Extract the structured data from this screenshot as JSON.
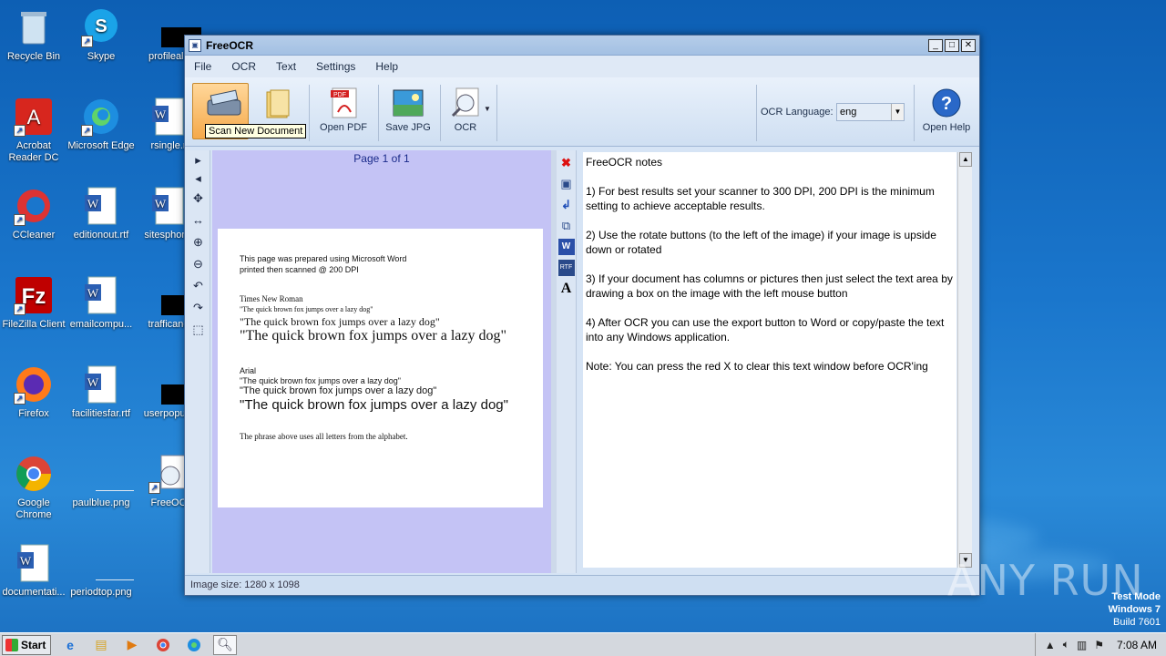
{
  "desktop": {
    "icons": [
      {
        "label": "Recycle Bin"
      },
      {
        "label": "Skype"
      },
      {
        "label": "profileal.j"
      },
      {
        "label": "Acrobat Reader DC"
      },
      {
        "label": "Microsoft Edge"
      },
      {
        "label": "rsingle.r"
      },
      {
        "label": "CCleaner"
      },
      {
        "label": "editionout.rtf"
      },
      {
        "label": "sitesphone"
      },
      {
        "label": "FileZilla Client"
      },
      {
        "label": "emailcompu..."
      },
      {
        "label": "trafficand"
      },
      {
        "label": "Firefox"
      },
      {
        "label": "facilitiesfar.rtf"
      },
      {
        "label": "userpopula"
      },
      {
        "label": "Google Chrome"
      },
      {
        "label": "paulblue.png"
      },
      {
        "label": "FreeOC"
      },
      {
        "label": "documentati..."
      },
      {
        "label": "periodtop.png"
      }
    ]
  },
  "window": {
    "title": "FreeOCR",
    "menu": [
      "File",
      "OCR",
      "Text",
      "Settings",
      "Help"
    ],
    "toolbar": {
      "open_pdf": "Open PDF",
      "save_jpg": "Save JPG",
      "ocr": "OCR",
      "tooltip": "Scan New Document",
      "ocr_language_label": "OCR Language:",
      "ocr_language_value": "eng",
      "open_help": "Open Help"
    },
    "image_pane": {
      "page_label": "Page 1 of 1",
      "doc_lines": [
        "This page was prepared using Microsoft Word",
        "printed then scanned @ 200 DPI",
        "Times New Roman",
        "\"The quick brown fox jumps over a lazy dog\"",
        "\"The quick brown fox jumps over a lazy dog\"",
        "\"The quick brown fox jumps over a lazy dog\"",
        "Arial",
        "\"The quick brown fox jumps over a lazy dog\"",
        "\"The quick brown fox  jumps over a lazy dog\"",
        "\"The quick brown fox jumps over a lazy dog\"",
        "The phrase above uses all letters from the alphabet."
      ]
    },
    "text_pane": {
      "paragraphs": [
        "FreeOCR notes",
        "1) For best results set your scanner to 300 DPI, 200 DPI is the minimum setting to achieve acceptable results.",
        "2) Use the rotate buttons (to the left of the image) if your image is upside down or rotated",
        "3) If your document has columns or pictures then just select the text area by drawing a box on the image with the left mouse button",
        "4) After OCR you can use the export button to Word or copy/paste the text into any Windows application.",
        "Note: You can press the red X to clear this text window before OCR'ing"
      ]
    },
    "status": "Image size:  1280 x 1098"
  },
  "watermark": "ANY RUN",
  "test_mode": {
    "line1": "Test Mode",
    "line2": "Windows 7",
    "line3": "Build 7601"
  },
  "taskbar": {
    "start": "Start",
    "clock": "7:08 AM"
  }
}
